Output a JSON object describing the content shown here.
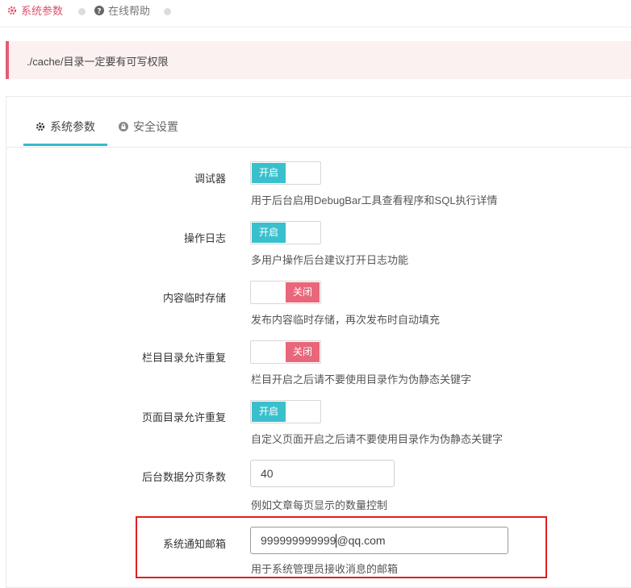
{
  "breadcrumbs": [
    {
      "label": "系统参数",
      "icon": "gear-icon",
      "active": true
    },
    {
      "label": "在线帮助",
      "icon": "question-circle-icon",
      "active": false
    }
  ],
  "alert": {
    "text": "./cache/目录一定要有可写权限"
  },
  "tabs": [
    {
      "label": "系统参数",
      "icon": "gear-icon",
      "active": true
    },
    {
      "label": "安全设置",
      "icon": "lock-icon",
      "active": false
    }
  ],
  "settings": [
    {
      "label": "调试器",
      "type": "toggle",
      "state": "on",
      "state_text": "开启",
      "hint": "用于后台启用DebugBar工具查看程序和SQL执行详情"
    },
    {
      "label": "操作日志",
      "type": "toggle",
      "state": "on",
      "state_text": "开启",
      "hint": "多用户操作后台建议打开日志功能"
    },
    {
      "label": "内容临时存储",
      "type": "toggle",
      "state": "off",
      "state_text": "关闭",
      "hint": "发布内容临时存储，再次发布时自动填充"
    },
    {
      "label": "栏目目录允许重复",
      "type": "toggle",
      "state": "off",
      "state_text": "关闭",
      "hint": "栏目开启之后请不要使用目录作为伪静态关键字"
    },
    {
      "label": "页面目录允许重复",
      "type": "toggle",
      "state": "on",
      "state_text": "开启",
      "hint": "自定义页面开启之后请不要使用目录作为伪静态关键字"
    },
    {
      "label": "后台数据分页条数",
      "type": "input",
      "value": "40",
      "hint": "例如文章每页显示的数量控制"
    },
    {
      "label": "系统通知邮箱",
      "type": "input",
      "value_before_caret": "999999999999",
      "value_after_caret": "@qq.com",
      "hint": "用于系统管理员接收消息的邮箱",
      "highlighted": true
    }
  ],
  "colors": {
    "accent": "#3ac0cd",
    "on": "#3ac0cd",
    "off": "#e8677a",
    "active_crumb": "#e0506a",
    "highlight": "#e02020"
  }
}
